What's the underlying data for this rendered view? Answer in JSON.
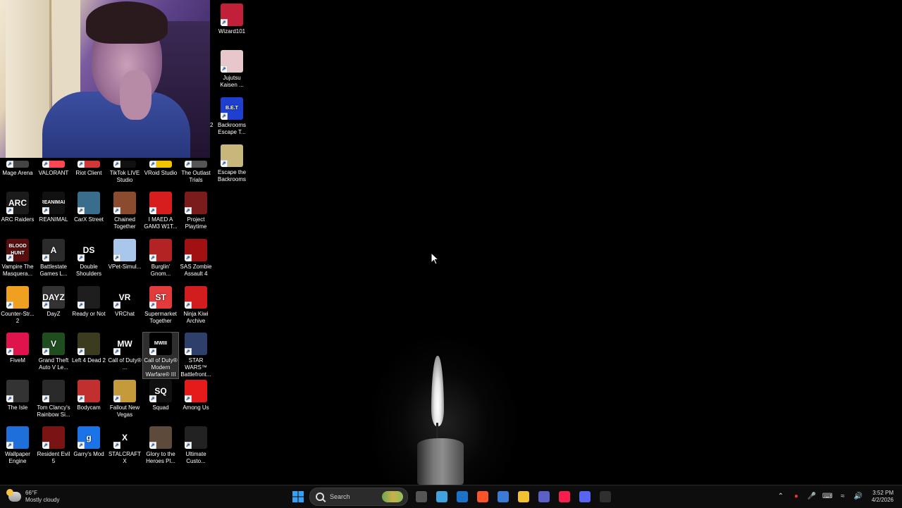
{
  "desktop": {
    "icons_right_column": [
      {
        "label": "Wizard101",
        "icon": "wizard101-icon",
        "color": "#c21f3b"
      },
      {
        "label": "Jujutsu Kaisen ...",
        "icon": "jujutsu-kaisen-icon",
        "color": "#e7c6cc"
      },
      {
        "label": "Backrooms Escape T...",
        "icon": "backrooms-escape-icon",
        "color": "#1f3fd1",
        "badge_text": "B.E.T",
        "side_number": "2"
      },
      {
        "label": "Escape the Backrooms",
        "icon": "escape-backrooms-icon",
        "color": "#c7b77a"
      }
    ],
    "grid_rows": [
      [
        {
          "label": "Mage Arena",
          "icon": "mage-arena-icon",
          "color": "#444"
        },
        {
          "label": "VALORANT",
          "icon": "valorant-icon",
          "color": "#ff4655"
        },
        {
          "label": "Riot Client",
          "icon": "riot-client-icon",
          "color": "#d13639"
        },
        {
          "label": "TikTok LIVE Studio",
          "icon": "tiktok-live-studio-icon",
          "color": "#111"
        },
        {
          "label": "VRoid Studio",
          "icon": "vroid-studio-icon",
          "color": "#f2c200"
        },
        {
          "label": "The Outlast Trials",
          "icon": "outlast-trials-icon",
          "color": "#555"
        }
      ],
      [
        {
          "label": "ARC Raiders",
          "icon": "arc-raiders-icon",
          "color": "#1b1b1b",
          "text": "ARC"
        },
        {
          "label": "REANIMAL",
          "icon": "reanimal-icon",
          "color": "#111",
          "text": "REANIMAL"
        },
        {
          "label": "CarX Street",
          "icon": "carx-street-icon",
          "color": "#3a6d8c"
        },
        {
          "label": "Chained Together",
          "icon": "chained-together-icon",
          "color": "#8a4b2e"
        },
        {
          "label": "I MAED A GAM3 W1T...",
          "icon": "i-maed-a-gam3-icon",
          "color": "#d81d1d"
        },
        {
          "label": "Project Playtime",
          "icon": "project-playtime-icon",
          "color": "#7a1c1c"
        }
      ],
      [
        {
          "label": "Vampire The Masquera...",
          "icon": "vampire-masquerade-icon",
          "color": "#5a0d0d",
          "text": "BLOOD HUNT"
        },
        {
          "label": "Battlestate Games L...",
          "icon": "battlestate-games-icon",
          "color": "#2b2b2b",
          "text": "A"
        },
        {
          "label": "Double Shoulders",
          "icon": "double-shoulders-icon",
          "color": "#000",
          "text": "DS"
        },
        {
          "label": "VPet-Simul...",
          "icon": "vpet-simulator-icon",
          "color": "#a9c7ea"
        },
        {
          "label": "Burglin' Gnom...",
          "icon": "burglin-gnomes-icon",
          "color": "#b32323"
        },
        {
          "label": "SAS Zombie Assault 4",
          "icon": "sas-zombie-assault-icon",
          "color": "#a11111"
        }
      ],
      [
        {
          "label": "Counter-Str... 2",
          "icon": "counter-strike-2-icon",
          "color": "#f0a020"
        },
        {
          "label": "DayZ",
          "icon": "dayz-icon",
          "color": "#333",
          "text": "DAYZ"
        },
        {
          "label": "Ready or Not",
          "icon": "ready-or-not-icon",
          "color": "#1e1e1e"
        },
        {
          "label": "VRChat",
          "icon": "vrchat-icon",
          "color": "#000",
          "text": "VR"
        },
        {
          "label": "Supermarket Together",
          "icon": "supermarket-together-icon",
          "color": "#e23b3b",
          "text": "ST"
        },
        {
          "label": "Ninja Kiwi Archive",
          "icon": "ninja-kiwi-archive-icon",
          "color": "#d11d1d"
        }
      ],
      [
        {
          "label": "FiveM",
          "icon": "fivem-icon",
          "color": "#e0144c"
        },
        {
          "label": "Grand Theft Auto V Le...",
          "icon": "gta-v-icon",
          "color": "#1f4d1f",
          "text": "V"
        },
        {
          "label": "Left 4 Dead 2",
          "icon": "left-4-dead-2-icon",
          "color": "#3b3b1f"
        },
        {
          "label": "Call of Duty® ...",
          "icon": "call-of-duty-icon",
          "color": "#000",
          "text": "MW"
        },
        {
          "label": "Call of Duty® Modern Warfare® III",
          "icon": "cod-mw3-icon",
          "color": "#000",
          "text": "MWIII",
          "selected": true
        },
        {
          "label": "STAR WARS™ Battlefront...",
          "icon": "star-wars-battlefront-icon",
          "color": "#2e3f6b"
        }
      ],
      [
        {
          "label": "The Isle",
          "icon": "the-isle-icon",
          "color": "#333"
        },
        {
          "label": "Tom Clancy's Rainbow Si...",
          "icon": "rainbow-six-icon",
          "color": "#2a2a2a"
        },
        {
          "label": "Bodycam",
          "icon": "bodycam-icon",
          "color": "#c12f2f"
        },
        {
          "label": "Fallout New Vegas",
          "icon": "fallout-new-vegas-icon",
          "color": "#c59a3a"
        },
        {
          "label": "Squad",
          "icon": "squad-icon",
          "color": "#111",
          "text": "SQ"
        },
        {
          "label": "Among Us",
          "icon": "among-us-icon",
          "color": "#e51b1b"
        }
      ],
      [
        {
          "label": "Wallpaper Engine",
          "icon": "wallpaper-engine-icon",
          "color": "#1e6fd9"
        },
        {
          "label": "Resident Evil 5",
          "icon": "resident-evil-5-icon",
          "color": "#7a1414"
        },
        {
          "label": "Garry's Mod",
          "icon": "garrys-mod-icon",
          "color": "#1b73e8",
          "text": "g"
        },
        {
          "label": "STALCRAFT X",
          "icon": "stalcraft-x-icon",
          "color": "#000",
          "text": "X"
        },
        {
          "label": "Glory to the Heroes Pl...",
          "icon": "glory-to-the-heroes-icon",
          "color": "#5e4a3a"
        },
        {
          "label": "Ultimate Custo...",
          "icon": "ultimate-custom-night-icon",
          "color": "#222"
        }
      ]
    ]
  },
  "taskbar": {
    "weather": {
      "temp": "66°F",
      "condition": "Mostly cloudy"
    },
    "search_placeholder": "Search",
    "apps": [
      {
        "icon": "file-explorer-icon",
        "color": "#555"
      },
      {
        "icon": "copilot-icon",
        "color": "#3fa3e0"
      },
      {
        "icon": "outlook-icon",
        "color": "#1a73c9"
      },
      {
        "icon": "brave-browser-icon",
        "color": "#fb542b"
      },
      {
        "icon": "microsoft-store-icon",
        "color": "#3a7bd5"
      },
      {
        "icon": "folder-icon",
        "color": "#f2c230"
      },
      {
        "icon": "teams-icon",
        "color": "#5b5fc7"
      },
      {
        "icon": "opera-gx-icon",
        "color": "#fa1e4e"
      },
      {
        "icon": "discord-icon",
        "color": "#5865f2"
      },
      {
        "icon": "obs-studio-icon",
        "color": "#302e31"
      }
    ],
    "clock": {
      "time": "3:52 PM",
      "date": "4/2/2026"
    }
  }
}
